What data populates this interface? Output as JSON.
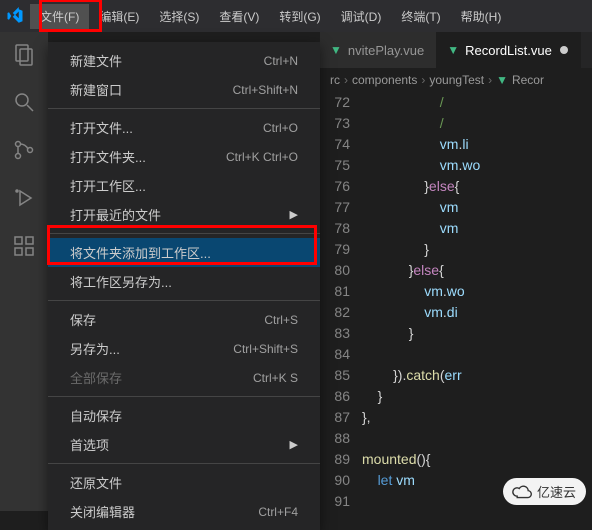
{
  "menubar": {
    "items": [
      {
        "label": "文件(F)"
      },
      {
        "label": "编辑(E)"
      },
      {
        "label": "选择(S)"
      },
      {
        "label": "查看(V)"
      },
      {
        "label": "转到(G)"
      },
      {
        "label": "调试(D)"
      },
      {
        "label": "终端(T)"
      },
      {
        "label": "帮助(H)"
      }
    ]
  },
  "dropdown": {
    "groups": [
      [
        {
          "label": "新建文件",
          "shortcut": "Ctrl+N"
        },
        {
          "label": "新建窗口",
          "shortcut": "Ctrl+Shift+N"
        }
      ],
      [
        {
          "label": "打开文件...",
          "shortcut": "Ctrl+O"
        },
        {
          "label": "打开文件夹...",
          "shortcut": "Ctrl+K Ctrl+O"
        },
        {
          "label": "打开工作区..."
        },
        {
          "label": "打开最近的文件",
          "submenu": true
        }
      ],
      [
        {
          "label": "将文件夹添加到工作区...",
          "highlight": true
        },
        {
          "label": "将工作区另存为..."
        }
      ],
      [
        {
          "label": "保存",
          "shortcut": "Ctrl+S"
        },
        {
          "label": "另存为...",
          "shortcut": "Ctrl+Shift+S"
        },
        {
          "label": "全部保存",
          "shortcut": "Ctrl+K S",
          "disabled": true
        }
      ],
      [
        {
          "label": "自动保存"
        },
        {
          "label": "首选项",
          "submenu": true
        }
      ],
      [
        {
          "label": "还原文件"
        },
        {
          "label": "关闭编辑器",
          "shortcut": "Ctrl+F4"
        }
      ]
    ]
  },
  "tabs": {
    "items": [
      {
        "label": "nvitePlay.vue",
        "active": false
      },
      {
        "label": "RecordList.vue",
        "active": true,
        "modified": true
      }
    ]
  },
  "breadcrumb": {
    "parts": [
      "rc",
      "components",
      "youngTest",
      "Recor"
    ]
  },
  "code": {
    "start": 72,
    "lines": [
      {
        "n": 72,
        "html": "                    <span class='c-comment'>/</span>"
      },
      {
        "n": 73,
        "html": "                    <span class='c-comment'>/</span>"
      },
      {
        "n": 74,
        "html": "                    <span class='c-ident'>vm</span><span class='c-punct'>.</span><span class='c-ident'>li</span>"
      },
      {
        "n": 75,
        "html": "                    <span class='c-ident'>vm</span><span class='c-punct'>.</span><span class='c-ident'>wo</span>"
      },
      {
        "n": 76,
        "html": "                <span class='c-punct'>}</span><span class='c-keyword'>else</span><span class='c-punct'>{</span>"
      },
      {
        "n": 77,
        "html": "                    <span class='c-ident'>vm</span>"
      },
      {
        "n": 78,
        "html": "                    <span class='c-ident'>vm</span>"
      },
      {
        "n": 79,
        "html": "                <span class='c-punct'>}</span>"
      },
      {
        "n": 80,
        "html": "            <span class='c-punct'>}</span><span class='c-keyword'>else</span><span class='c-punct'>{</span>"
      },
      {
        "n": 81,
        "html": "                <span class='c-ident'>vm</span><span class='c-punct'>.</span><span class='c-ident'>wo</span>"
      },
      {
        "n": 82,
        "html": "                <span class='c-ident'>vm</span><span class='c-punct'>.</span><span class='c-ident'>di</span>"
      },
      {
        "n": 83,
        "html": "            <span class='c-punct'>}</span>"
      },
      {
        "n": 84,
        "html": ""
      },
      {
        "n": 85,
        "html": "        <span class='c-punct'>}).</span><span class='c-method'>catch</span><span class='c-punct'>(</span><span class='c-ident'>err</span>"
      },
      {
        "n": 86,
        "html": "    <span class='c-punct'>}</span>"
      },
      {
        "n": 87,
        "html": "<span class='c-punct'>},</span>"
      },
      {
        "n": 88,
        "html": ""
      },
      {
        "n": 89,
        "html": "<span class='c-method'>mounted</span><span class='c-punct'>(){</span>"
      },
      {
        "n": 90,
        "html": "    <span class='c-kw2'>let</span> <span class='c-ident'>vm</span>"
      },
      {
        "n": 91,
        "html": ""
      }
    ]
  },
  "watermark": {
    "text": "亿速云"
  }
}
